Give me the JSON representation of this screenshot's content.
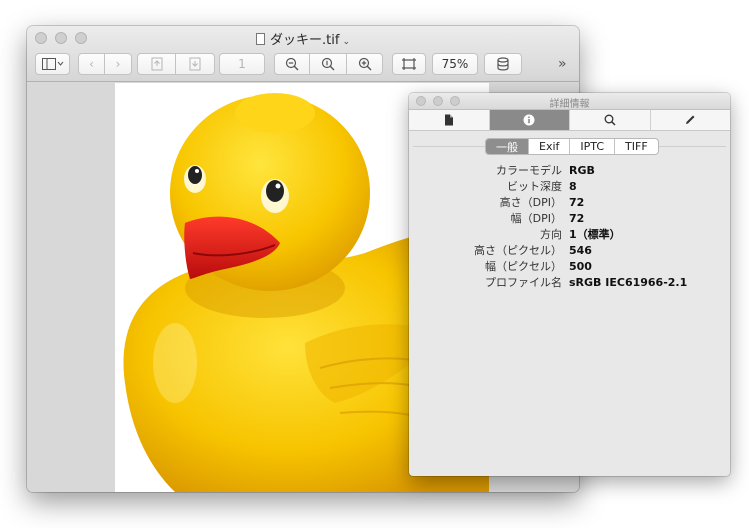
{
  "window": {
    "title": "ダッキー.tif",
    "zoom": "75%",
    "page_number": "1"
  },
  "toolbar": {
    "items": [
      "sidebar-toggle",
      "back",
      "forward",
      "prev-page",
      "next-page",
      "page-number",
      "zoom-out",
      "actual-size",
      "zoom-in",
      "fit",
      "zoom-level",
      "share"
    ],
    "overflow": "»"
  },
  "inspector": {
    "title": "詳細情報",
    "tabs": [
      "document-icon",
      "info-icon",
      "search-icon",
      "pencil-icon"
    ],
    "active_tab": 1,
    "segments": [
      "一般",
      "Exif",
      "IPTC",
      "TIFF"
    ],
    "active_segment": 0,
    "properties": [
      {
        "label": "カラーモデル",
        "value": "RGB"
      },
      {
        "label": "ビット深度",
        "value": "8"
      },
      {
        "label": "高さ（DPI）",
        "value": "72"
      },
      {
        "label": "幅（DPI）",
        "value": "72"
      },
      {
        "label": "方向",
        "value": "1（標準）"
      },
      {
        "label": "高さ（ピクセル）",
        "value": "546"
      },
      {
        "label": "幅（ピクセル）",
        "value": "500"
      },
      {
        "label": "プロファイル名",
        "value": "sRGB IEC61966-2.1"
      }
    ]
  },
  "colors": {
    "duck_yellow": "#f7c600",
    "beak_red": "#e01818"
  }
}
